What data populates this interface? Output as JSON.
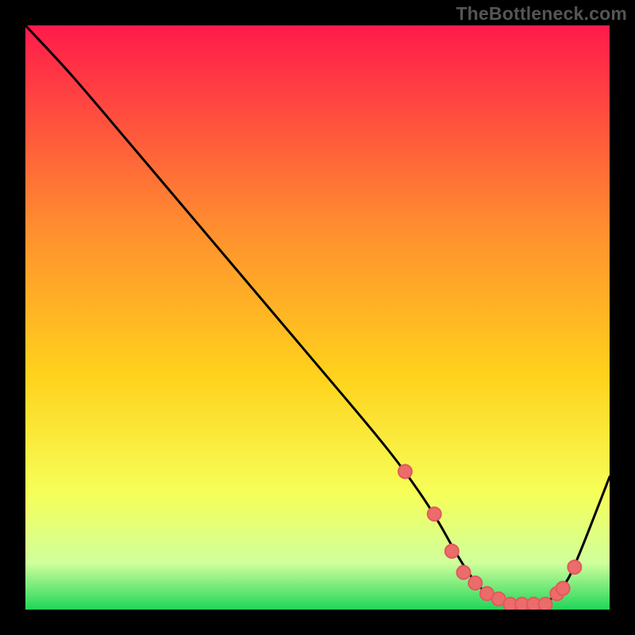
{
  "watermark": "TheBottleneck.com",
  "colors": {
    "black": "#000000",
    "curve": "#000000",
    "marker_fill": "#ec6b6b",
    "marker_stroke": "#e25a5a",
    "grad_top": "#ff1a4b",
    "grad_35": "#ff8f2f",
    "grad_60": "#ffd21c",
    "grad_80": "#f6ff58",
    "grad_92": "#d0ff9c",
    "grad_bottom": "#1fd65a"
  },
  "chart_data": {
    "type": "line",
    "title": "",
    "xlabel": "",
    "ylabel": "",
    "xlim": [
      0,
      100
    ],
    "ylim": [
      0,
      110
    ],
    "x": [
      0,
      6,
      10,
      20,
      30,
      40,
      50,
      60,
      65,
      70,
      74,
      77,
      80,
      83,
      86,
      89,
      92,
      94,
      100
    ],
    "values": [
      110,
      103,
      98,
      85,
      72,
      59,
      46,
      33,
      26,
      18,
      10,
      5,
      2,
      1,
      1,
      1,
      4,
      8,
      25
    ],
    "markers_x": [
      65,
      70,
      73,
      75,
      77,
      79,
      81,
      83,
      85,
      87,
      89,
      91,
      92,
      94
    ],
    "markers_y": [
      26,
      18,
      11,
      7,
      5,
      3,
      2,
      1,
      1,
      1,
      1,
      3,
      4,
      8
    ]
  }
}
